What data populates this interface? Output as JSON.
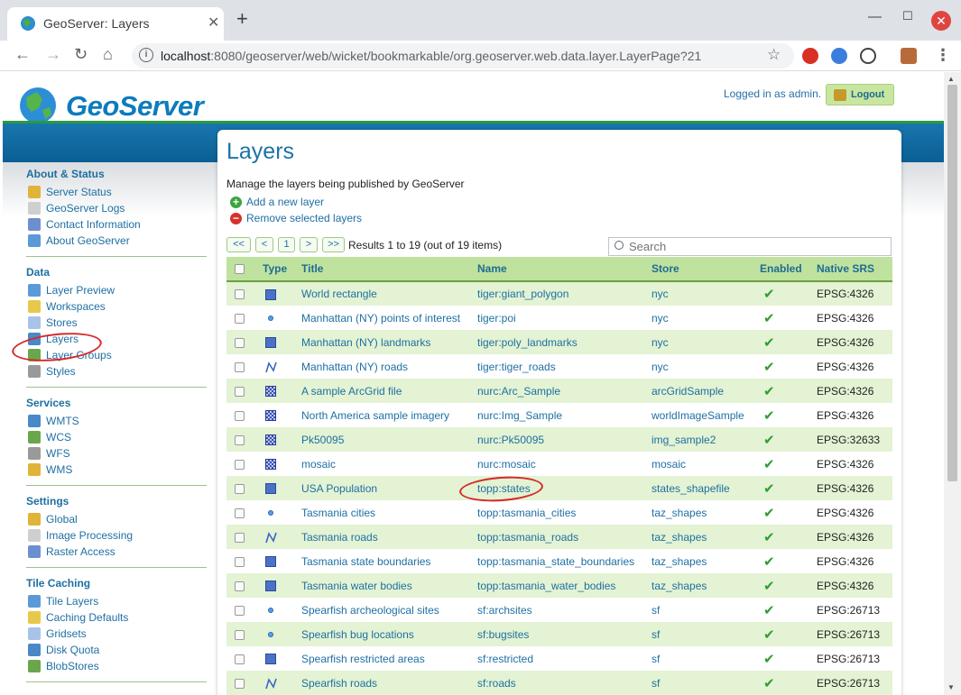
{
  "browser": {
    "tab_title": "GeoServer: Layers",
    "url_host": "localhost",
    "url_rest": ":8080/geoserver/web/wicket/bookmarkable/org.geoserver.web.data.layer.LayerPage?21"
  },
  "header": {
    "logo": "GeoServer",
    "logged_in": "Logged in as admin.",
    "logout": "Logout"
  },
  "sidebar": {
    "sections": [
      {
        "title": "About & Status",
        "items": [
          "Server Status",
          "GeoServer Logs",
          "Contact Information",
          "About GeoServer"
        ]
      },
      {
        "title": "Data",
        "items": [
          "Layer Preview",
          "Workspaces",
          "Stores",
          "Layers",
          "Layer Groups",
          "Styles"
        ]
      },
      {
        "title": "Services",
        "items": [
          "WMTS",
          "WCS",
          "WFS",
          "WMS"
        ]
      },
      {
        "title": "Settings",
        "items": [
          "Global",
          "Image Processing",
          "Raster Access"
        ]
      },
      {
        "title": "Tile Caching",
        "items": [
          "Tile Layers",
          "Caching Defaults",
          "Gridsets",
          "Disk Quota",
          "BlobStores"
        ]
      }
    ]
  },
  "main": {
    "title": "Layers",
    "description": "Manage the layers being published by GeoServer",
    "add_layer": "Add a new layer",
    "remove_layers": "Remove selected layers",
    "pager": {
      "first": "<<",
      "prev": "<",
      "page": "1",
      "next": ">",
      "last": ">>"
    },
    "results": "Results 1 to 19 (out of 19 items)",
    "search_placeholder": "Search",
    "columns": [
      "Type",
      "Title",
      "Name",
      "Store",
      "Enabled",
      "Native SRS"
    ],
    "rows": [
      {
        "type": "polygon",
        "title": "World rectangle",
        "name": "tiger:giant_polygon",
        "store": "nyc",
        "srs": "EPSG:4326"
      },
      {
        "type": "point",
        "title": "Manhattan (NY) points of interest",
        "name": "tiger:poi",
        "store": "nyc",
        "srs": "EPSG:4326"
      },
      {
        "type": "polygon",
        "title": "Manhattan (NY) landmarks",
        "name": "tiger:poly_landmarks",
        "store": "nyc",
        "srs": "EPSG:4326"
      },
      {
        "type": "line",
        "title": "Manhattan (NY) roads",
        "name": "tiger:tiger_roads",
        "store": "nyc",
        "srs": "EPSG:4326"
      },
      {
        "type": "raster",
        "title": "A sample ArcGrid file",
        "name": "nurc:Arc_Sample",
        "store": "arcGridSample",
        "srs": "EPSG:4326"
      },
      {
        "type": "raster",
        "title": "North America sample imagery",
        "name": "nurc:Img_Sample",
        "store": "worldImageSample",
        "srs": "EPSG:4326"
      },
      {
        "type": "raster",
        "title": "Pk50095",
        "name": "nurc:Pk50095",
        "store": "img_sample2",
        "srs": "EPSG:32633"
      },
      {
        "type": "raster",
        "title": "mosaic",
        "name": "nurc:mosaic",
        "store": "mosaic",
        "srs": "EPSG:4326"
      },
      {
        "type": "polygon",
        "title": "USA Population",
        "name": "topp:states",
        "store": "states_shapefile",
        "srs": "EPSG:4326"
      },
      {
        "type": "point",
        "title": "Tasmania cities",
        "name": "topp:tasmania_cities",
        "store": "taz_shapes",
        "srs": "EPSG:4326"
      },
      {
        "type": "line",
        "title": "Tasmania roads",
        "name": "topp:tasmania_roads",
        "store": "taz_shapes",
        "srs": "EPSG:4326"
      },
      {
        "type": "polygon",
        "title": "Tasmania state boundaries",
        "name": "topp:tasmania_state_boundaries",
        "store": "taz_shapes",
        "srs": "EPSG:4326"
      },
      {
        "type": "polygon",
        "title": "Tasmania water bodies",
        "name": "topp:tasmania_water_bodies",
        "store": "taz_shapes",
        "srs": "EPSG:4326"
      },
      {
        "type": "point",
        "title": "Spearfish archeological sites",
        "name": "sf:archsites",
        "store": "sf",
        "srs": "EPSG:26713"
      },
      {
        "type": "point",
        "title": "Spearfish bug locations",
        "name": "sf:bugsites",
        "store": "sf",
        "srs": "EPSG:26713"
      },
      {
        "type": "polygon",
        "title": "Spearfish restricted areas",
        "name": "sf:restricted",
        "store": "sf",
        "srs": "EPSG:26713"
      },
      {
        "type": "line",
        "title": "Spearfish roads",
        "name": "sf:roads",
        "store": "sf",
        "srs": "EPSG:26713"
      }
    ]
  }
}
